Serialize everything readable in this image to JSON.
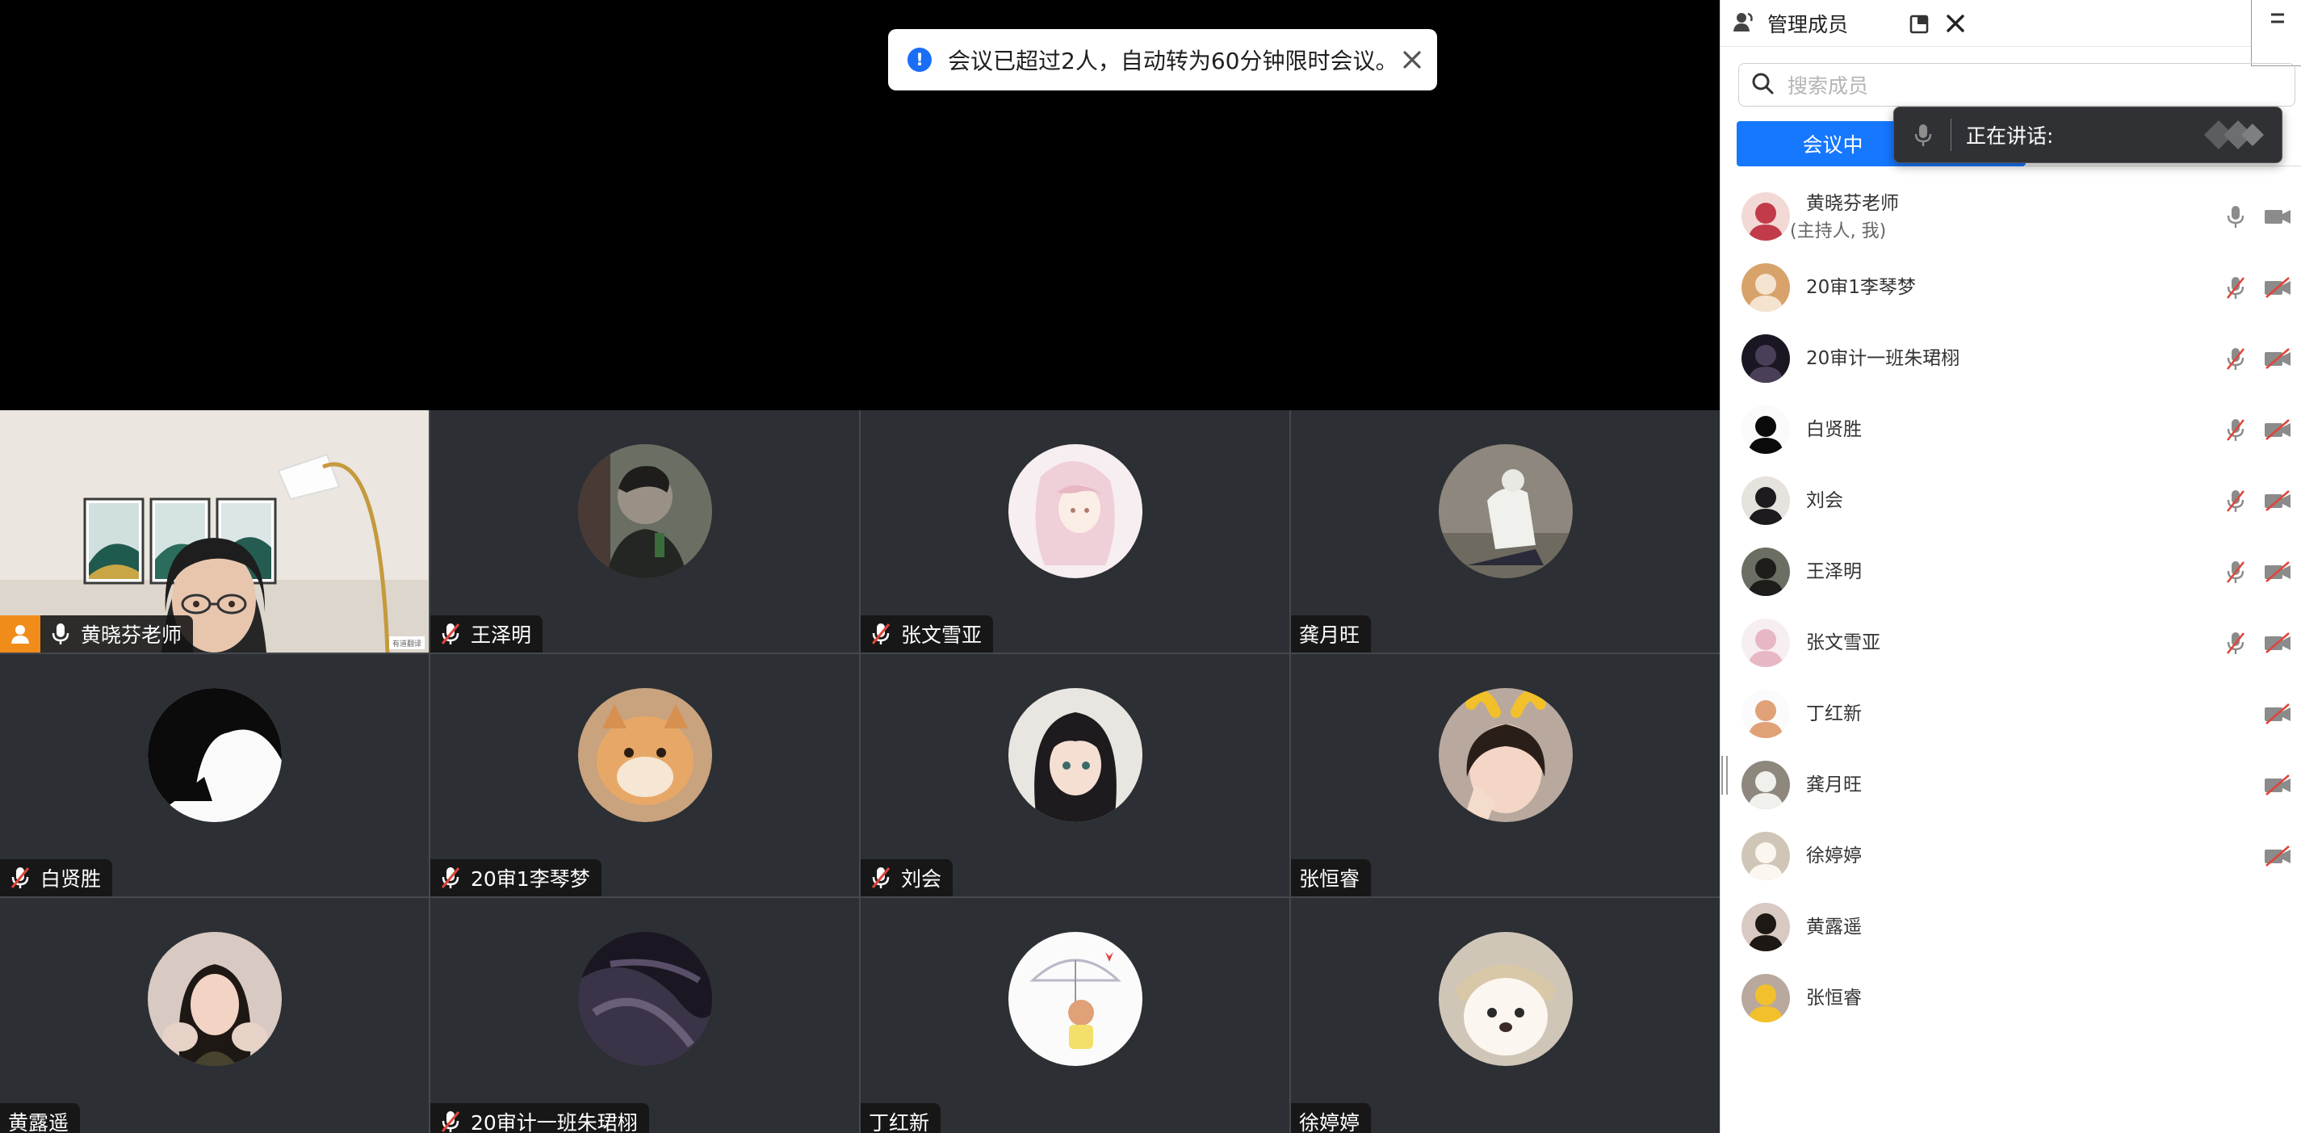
{
  "banner": {
    "text": "会议已超过2人，自动转为60分钟限时会议。",
    "info_icon": "info-icon",
    "close_icon": "close-icon"
  },
  "video_tiles": [
    {
      "name": "黄晓芬老师",
      "mic": "on",
      "host": true,
      "video": true
    },
    {
      "name": "王泽明",
      "mic": "muted"
    },
    {
      "name": "张文雪亚",
      "mic": "muted"
    },
    {
      "name": "龚月旺",
      "mic": "none"
    },
    {
      "name": "白贤胜",
      "mic": "muted"
    },
    {
      "name": "20审1李琴梦",
      "mic": "muted"
    },
    {
      "name": "刘会",
      "mic": "muted"
    },
    {
      "name": "张恒睿",
      "mic": "none"
    },
    {
      "name": "黄露遥",
      "mic": "none"
    },
    {
      "name": "20审计一班朱珺栩",
      "mic": "muted"
    },
    {
      "name": "丁红新",
      "mic": "none"
    },
    {
      "name": "徐婷婷",
      "mic": "none"
    }
  ],
  "panel": {
    "title": "管理成员",
    "search_placeholder": "搜索成员",
    "active_tab": "会议中",
    "speaking_label": "正在讲话:",
    "members": [
      {
        "name": "黄晓芬老师",
        "sub": "(主持人, 我)",
        "mic": "on",
        "cam": "on"
      },
      {
        "name": "20审1李琴梦",
        "mic": "off",
        "cam": "off"
      },
      {
        "name": "20审计一班朱珺栩",
        "mic": "off",
        "cam": "off"
      },
      {
        "name": "白贤胜",
        "mic": "off",
        "cam": "off"
      },
      {
        "name": "刘会",
        "mic": "off",
        "cam": "off"
      },
      {
        "name": "王泽明",
        "mic": "off",
        "cam": "off"
      },
      {
        "name": "张文雪亚",
        "mic": "off",
        "cam": "off"
      },
      {
        "name": "丁红新",
        "mic": "none",
        "cam": "off"
      },
      {
        "name": "龚月旺",
        "mic": "none",
        "cam": "off"
      },
      {
        "name": "徐婷婷",
        "mic": "none",
        "cam": "off"
      },
      {
        "name": "黄露遥",
        "mic": "none",
        "cam": "none"
      },
      {
        "name": "张恒睿",
        "mic": "none",
        "cam": "none"
      }
    ]
  },
  "colors": {
    "accent": "#1677ff",
    "host_badge": "#f08c1a",
    "muted_red": "#e0443a",
    "tile_bg": "#2c2f33"
  }
}
